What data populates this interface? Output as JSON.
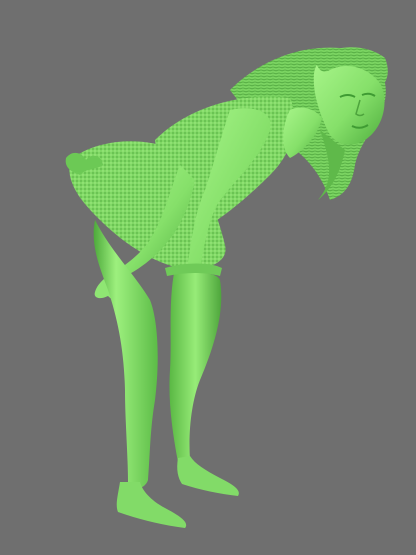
{
  "viewport": {
    "background_color": "#6f6f6f",
    "model_color": "#88e36d",
    "model_shadow_color": "#3f9b33",
    "model_highlight_color": "#c4ff9d"
  },
  "model": {
    "subject": "female-figure-bending-forward",
    "render_style": "green-shaded-3d-relief"
  }
}
